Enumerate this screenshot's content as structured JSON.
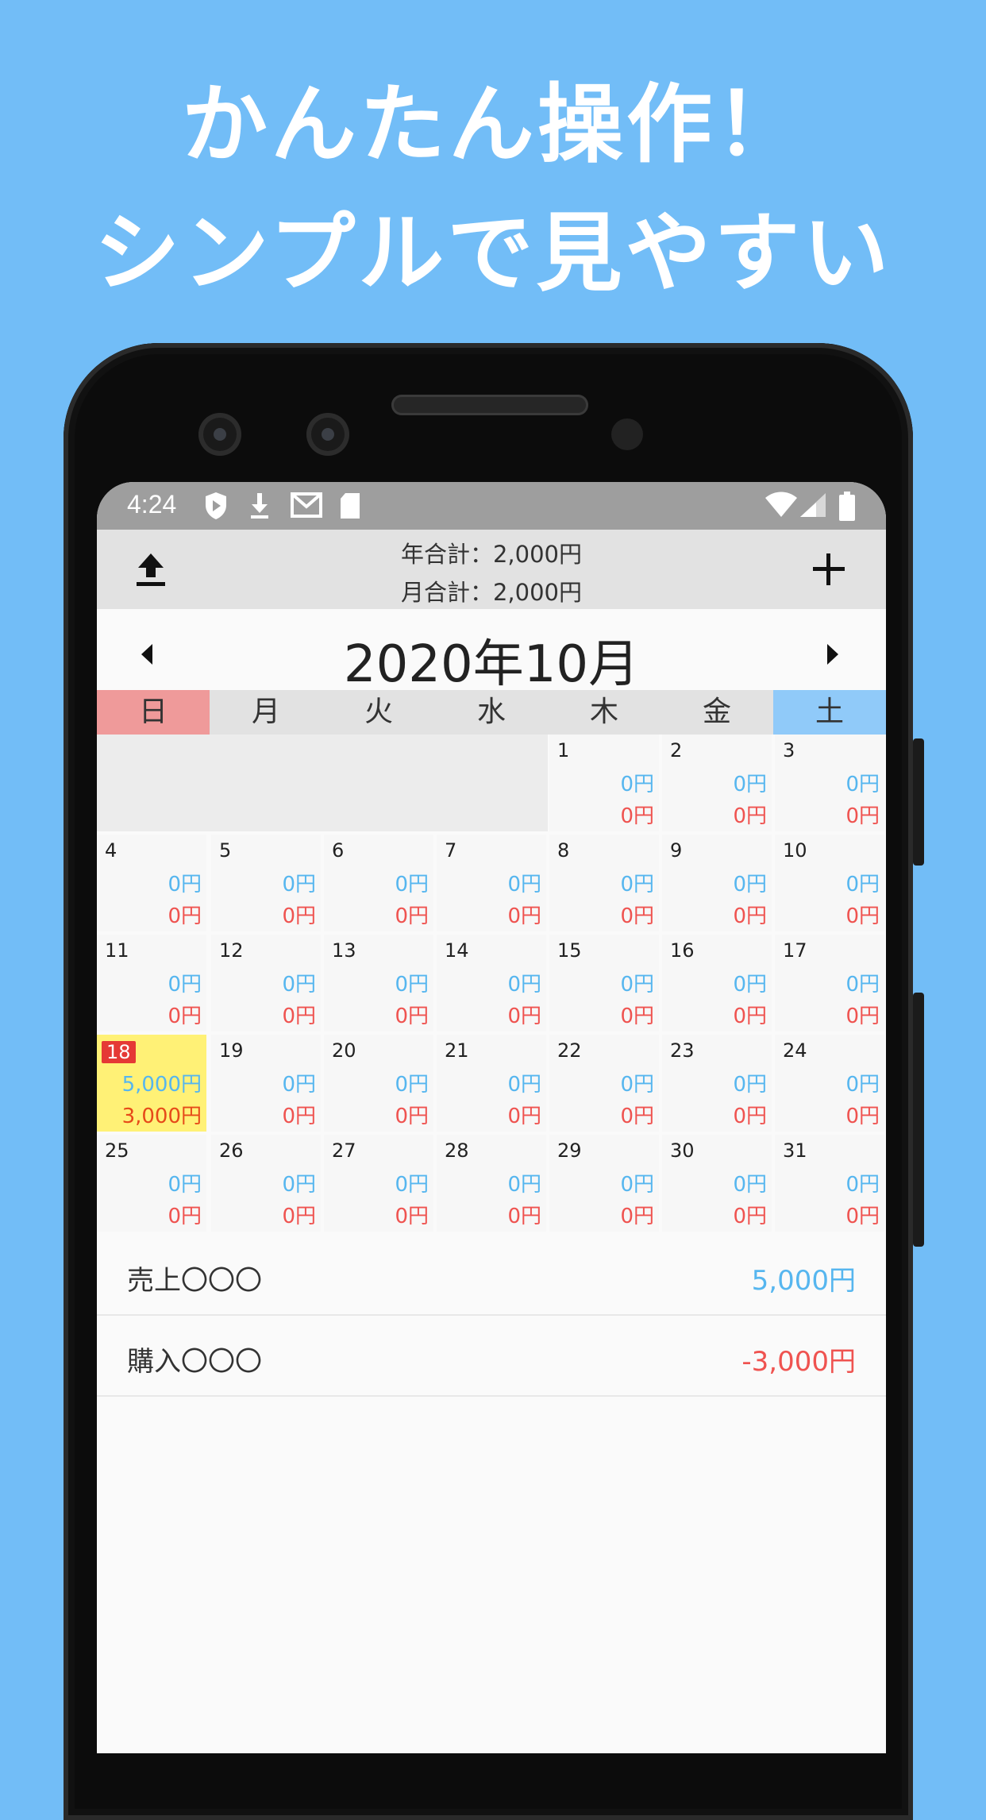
{
  "promo": {
    "line1": "かんたん操作！",
    "line2": "シンプルで見やすい"
  },
  "statusbar": {
    "time": "4:24"
  },
  "appbar": {
    "year_total": "年合計：2,000円",
    "month_total": "月合計：2,000円"
  },
  "calendar": {
    "month_title": "2020年10月",
    "weekdays": [
      "日",
      "月",
      "火",
      "水",
      "木",
      "金",
      "土"
    ],
    "today": "18",
    "days": [
      {
        "d": "1",
        "inc": "0円",
        "exp": "0円"
      },
      {
        "d": "2",
        "inc": "0円",
        "exp": "0円"
      },
      {
        "d": "3",
        "inc": "0円",
        "exp": "0円"
      },
      {
        "d": "4",
        "inc": "0円",
        "exp": "0円"
      },
      {
        "d": "5",
        "inc": "0円",
        "exp": "0円"
      },
      {
        "d": "6",
        "inc": "0円",
        "exp": "0円"
      },
      {
        "d": "7",
        "inc": "0円",
        "exp": "0円"
      },
      {
        "d": "8",
        "inc": "0円",
        "exp": "0円"
      },
      {
        "d": "9",
        "inc": "0円",
        "exp": "0円"
      },
      {
        "d": "10",
        "inc": "0円",
        "exp": "0円"
      },
      {
        "d": "11",
        "inc": "0円",
        "exp": "0円"
      },
      {
        "d": "12",
        "inc": "0円",
        "exp": "0円"
      },
      {
        "d": "13",
        "inc": "0円",
        "exp": "0円"
      },
      {
        "d": "14",
        "inc": "0円",
        "exp": "0円"
      },
      {
        "d": "15",
        "inc": "0円",
        "exp": "0円"
      },
      {
        "d": "16",
        "inc": "0円",
        "exp": "0円"
      },
      {
        "d": "17",
        "inc": "0円",
        "exp": "0円"
      },
      {
        "d": "18",
        "inc": "5,000円",
        "exp": "3,000円"
      },
      {
        "d": "19",
        "inc": "0円",
        "exp": "0円"
      },
      {
        "d": "20",
        "inc": "0円",
        "exp": "0円"
      },
      {
        "d": "21",
        "inc": "0円",
        "exp": "0円"
      },
      {
        "d": "22",
        "inc": "0円",
        "exp": "0円"
      },
      {
        "d": "23",
        "inc": "0円",
        "exp": "0円"
      },
      {
        "d": "24",
        "inc": "0円",
        "exp": "0円"
      },
      {
        "d": "25",
        "inc": "0円",
        "exp": "0円"
      },
      {
        "d": "26",
        "inc": "0円",
        "exp": "0円"
      },
      {
        "d": "27",
        "inc": "0円",
        "exp": "0円"
      },
      {
        "d": "28",
        "inc": "0円",
        "exp": "0円"
      },
      {
        "d": "29",
        "inc": "0円",
        "exp": "0円"
      },
      {
        "d": "30",
        "inc": "0円",
        "exp": "0円"
      },
      {
        "d": "31",
        "inc": "0円",
        "exp": "0円"
      }
    ]
  },
  "entries": [
    {
      "label": "売上〇〇〇",
      "amount": "5,000円",
      "type": "income"
    },
    {
      "label": "購入〇〇〇",
      "amount": "-3,000円",
      "type": "expense"
    }
  ],
  "colors": {
    "background": "#72bdf7",
    "income": "#56b6ef",
    "expense": "#ef5350",
    "today_highlight": "#fff176",
    "sunday": "#ef9a9a",
    "saturday": "#90caf9"
  },
  "icons": {
    "status": [
      "shield-icon",
      "download-icon",
      "gmail-icon",
      "sdcard-icon",
      "wifi-icon",
      "signal-icon",
      "battery-icon"
    ],
    "appbar": [
      "upload-icon",
      "plus-icon"
    ],
    "nav": [
      "chevron-left-icon",
      "chevron-right-icon"
    ]
  }
}
